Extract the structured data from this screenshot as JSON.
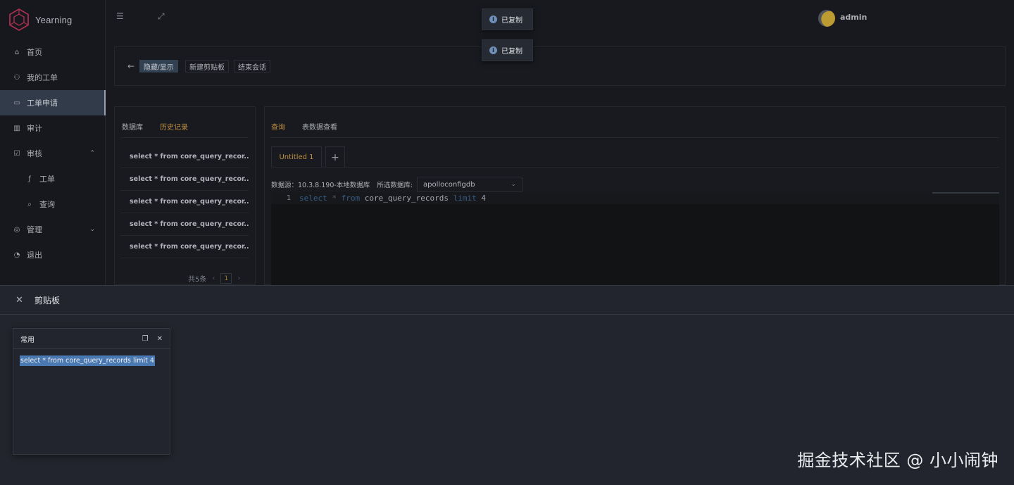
{
  "app": {
    "name": "Yearning"
  },
  "sidebar": {
    "items": [
      {
        "label": "首页",
        "icon": "home-icon"
      },
      {
        "label": "我的工单",
        "icon": "user-icon"
      },
      {
        "label": "工单申请",
        "icon": "monitor-icon",
        "active": true
      },
      {
        "label": "审计",
        "icon": "chart-icon"
      },
      {
        "label": "审核",
        "icon": "audit-icon",
        "expanded": true
      },
      {
        "label": "工单",
        "icon": "function-icon",
        "sub": true
      },
      {
        "label": "查询",
        "icon": "search-icon",
        "sub": true
      },
      {
        "label": "管理",
        "icon": "eye-icon",
        "expanded": false
      },
      {
        "label": "退出",
        "icon": "logout-icon"
      }
    ]
  },
  "header": {
    "user": "admin"
  },
  "toasts": [
    "已复制",
    "已复制"
  ],
  "toolbar": {
    "toggle_label": "隐藏/显示",
    "new_clip_label": "新建剪贴板",
    "end_session_label": "结束会话"
  },
  "left_panel": {
    "tabs": [
      "数据库",
      "历史记录"
    ],
    "active_tab": "历史记录",
    "history": [
      "select * from core_query_recor...",
      "select * from core_query_recor...",
      "select * from core_query_recor...",
      "select * from core_query_recor...",
      "select * from core_query_recor..."
    ],
    "pager": {
      "total": "共5条",
      "page": "1"
    }
  },
  "right_panel": {
    "tabs": [
      "查询",
      "表数据查看"
    ],
    "active_tab": "查询",
    "file_tab": "Untitled 1",
    "datasource_label": "数据源：10.3.8.190-本地数据库",
    "db_label": "所选数据库:",
    "db_value": "apolloconfigdb",
    "editor": {
      "line_number": "1",
      "sql": "select * from core_query_records limit 4"
    }
  },
  "drawer": {
    "title": "剪贴板",
    "card": {
      "title": "常用",
      "content": "select * from core_query_records limit 4"
    }
  },
  "watermark": "掘金技术社区 @ 小小闹钟",
  "colors": {
    "accent": "#d9a24a",
    "active_menu": "#3a4455",
    "selection": "#4a78b0"
  }
}
